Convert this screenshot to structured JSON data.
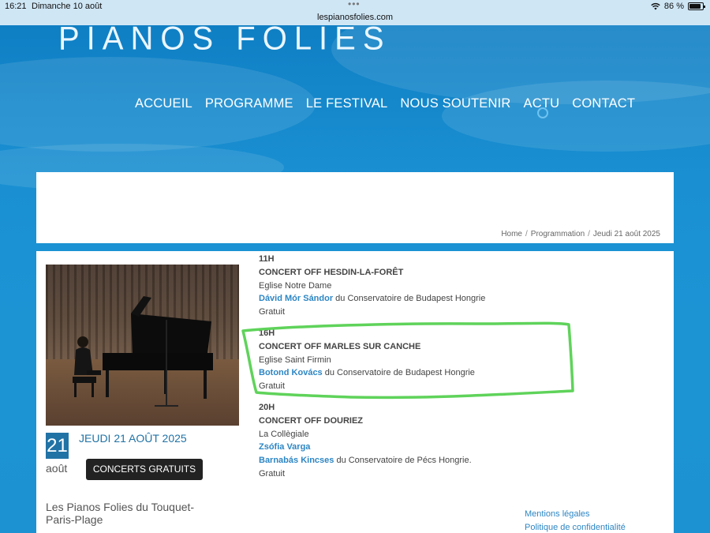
{
  "status": {
    "time": "16:21",
    "date": "Dimanche 10 août",
    "url": "lespianosfolies.com",
    "battery": "86 %",
    "battery_level": 0.86
  },
  "site": {
    "logo_text": "PIANOS FOLIES",
    "nav": [
      "ACCUEIL",
      "PROGRAMME",
      "LE FESTIVAL",
      "NOUS SOUTENIR",
      "ACTU",
      "CONTACT"
    ]
  },
  "breadcrumb": {
    "items": [
      "Home",
      "Programmation",
      "Jeudi 21 août 2025"
    ],
    "separator": "/"
  },
  "event": {
    "day": "21",
    "month": "août",
    "date_label": "JEUDI 21 AOÛT 2025",
    "tag": "CONCERTS GRATUITS"
  },
  "concerts": [
    {
      "time": "11H",
      "title": "CONCERT OFF HESDIN-LA-FORÊT",
      "venue": "Eglise Notre Dame",
      "artists": [
        {
          "name": "Dávid Mór Sándor",
          "suffix": " du Conservatoire de Budapest Hongrie"
        }
      ],
      "price": "Gratuit"
    },
    {
      "time": "16H",
      "title": "CONCERT OFF MARLES SUR CANCHE",
      "venue": "Eglise Saint Firmin",
      "artists": [
        {
          "name": "Botond Kovács",
          "suffix": " du Conservatoire de Budapest Hongrie"
        }
      ],
      "price": "Gratuit"
    },
    {
      "time": "20H",
      "title": "CONCERT OFF DOURIEZ",
      "venue": "La Collègiale",
      "artists": [
        {
          "name": "Zsófia Varga",
          "suffix": ""
        },
        {
          "name": "Barnabás Kincses",
          "suffix": " du Conservatoire de Pécs Hongrie."
        }
      ],
      "price": "Gratuit"
    }
  ],
  "footer": {
    "site_name": "Les Pianos Folies du Touquet-Paris-Plage",
    "links": [
      "Mentions légales",
      "Politique de confidentialité"
    ]
  },
  "colors": {
    "brand_blue": "#2173a6",
    "link_blue": "#2d86c4",
    "highlight_green": "#5fd35a"
  }
}
